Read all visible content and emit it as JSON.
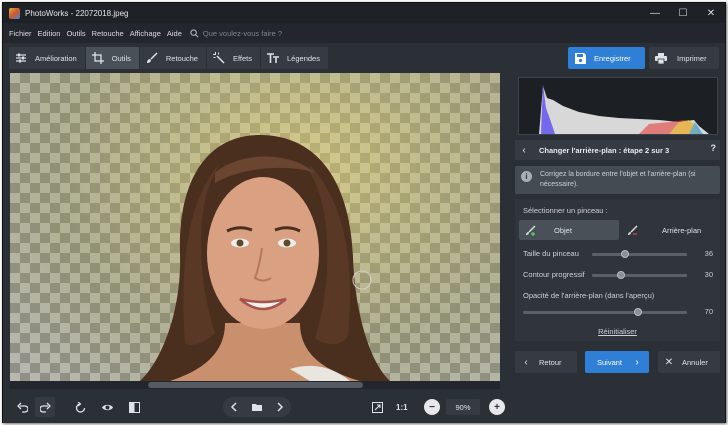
{
  "window": {
    "title": "PhotoWorks - 22072018.jpeg",
    "controls": [
      "—",
      "☐",
      "✕"
    ]
  },
  "menu": {
    "items": [
      "Fichier",
      "Edition",
      "Outils",
      "Retouche",
      "Affichage",
      "Aide"
    ],
    "search_placeholder": "Que voulez-vous faire ?"
  },
  "toolbar": {
    "tabs": [
      {
        "label": "Amélioration",
        "icon": "sliders-icon"
      },
      {
        "label": "Outils",
        "icon": "crop-icon",
        "active": true
      },
      {
        "label": "Retouche",
        "icon": "brush-icon"
      },
      {
        "label": "Effets",
        "icon": "magic-wand-icon"
      },
      {
        "label": "Légendes",
        "icon": "text-icon"
      }
    ],
    "save_label": "Enregistrer",
    "print_label": "Imprimer"
  },
  "bottom": {
    "one_to_one": "1:1",
    "zoom": "90%",
    "zoom_out": "−",
    "zoom_in": "+"
  },
  "panel": {
    "step_title": "Changer l'arrière-plan : étape 2 sur 3",
    "help": "?",
    "info": "Corrigez la bordure entre l'objet et l'arrière-plan (si nécessaire).",
    "select_brush_label": "Sélectionner un pinceau :",
    "brush_object": "Objet",
    "brush_background": "Arrière-plan",
    "sliders": [
      {
        "label": "Taille du pinceau",
        "value": 36,
        "fraction": 0.35
      },
      {
        "label": "Contour progressif",
        "value": 30,
        "fraction": 0.3
      },
      {
        "label": "Opacité de l'arrière-plan (dans l'aperçu)",
        "value": 70,
        "fraction": 0.7
      }
    ],
    "reset": "Réinitialiser",
    "back_label": "Retour",
    "next_label": "Suivant",
    "cancel_label": "Annuler"
  },
  "colors": {
    "accent": "#2f7fd6",
    "background": "#2b2f36"
  }
}
